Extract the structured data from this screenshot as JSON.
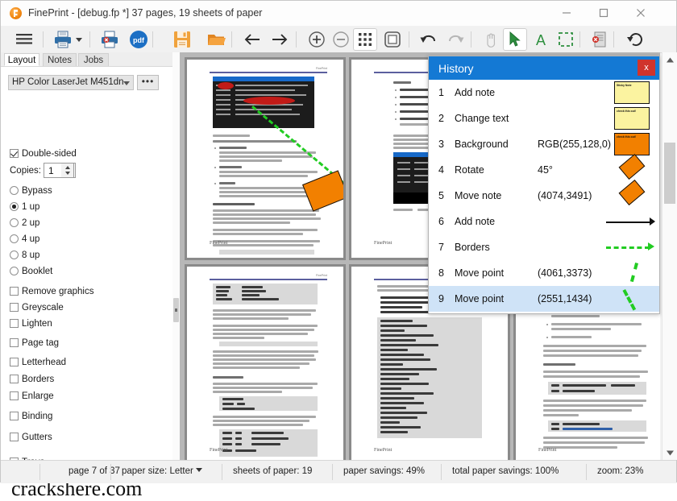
{
  "window": {
    "title": "FinePrint - [debug.fp *] 37 pages, 19 sheets of paper",
    "app_icon": "fineprint-logo-icon",
    "minimize": "minimize-icon",
    "maximize": "maximize-icon",
    "close": "close-icon"
  },
  "toolbar": {
    "buttons": [
      {
        "name": "menu-button",
        "icon": "hamburger-menu-icon"
      },
      {
        "name": "print-button",
        "icon": "printer-icon"
      },
      {
        "name": "print-dropdown",
        "icon": "chevron-down-icon"
      },
      {
        "name": "print-stamp-button",
        "icon": "printer-stamp-icon"
      },
      {
        "name": "pdf-button",
        "icon": "pdf-icon"
      },
      {
        "name": "save-button",
        "icon": "floppy-save-icon"
      },
      {
        "name": "open-button",
        "icon": "open-folder-icon"
      },
      {
        "name": "back-button",
        "icon": "arrow-left-icon"
      },
      {
        "name": "forward-button",
        "icon": "arrow-right-icon"
      },
      {
        "name": "zoom-in-button",
        "icon": "zoom-in-icon"
      },
      {
        "name": "zoom-out-button",
        "icon": "zoom-out-icon"
      },
      {
        "name": "grid-view-button",
        "icon": "grid-icon"
      },
      {
        "name": "fit-page-button",
        "icon": "fit-page-icon"
      },
      {
        "name": "undo-button",
        "icon": "undo-arrow-icon"
      },
      {
        "name": "redo-button",
        "icon": "redo-arrow-icon"
      },
      {
        "name": "hand-tool-button",
        "icon": "hand-icon"
      },
      {
        "name": "select-tool-button",
        "icon": "cursor-arrow-icon"
      },
      {
        "name": "text-tool-button",
        "icon": "letter-a-icon"
      },
      {
        "name": "marquee-tool-button",
        "icon": "dashed-rectangle-icon"
      },
      {
        "name": "delete-page-button",
        "icon": "delete-page-icon"
      },
      {
        "name": "rotate-button",
        "icon": "rotate-clockwise-icon"
      }
    ]
  },
  "sidebar": {
    "tabs": [
      {
        "label": "Layout",
        "selected": true
      },
      {
        "label": "Notes",
        "selected": false
      },
      {
        "label": "Jobs",
        "selected": false
      }
    ],
    "printer": "HP Color LaserJet M451dn",
    "printer_more_label": "•••",
    "double_sided": {
      "label": "Double-sided",
      "checked": true
    },
    "copies": {
      "label": "Copies:",
      "value": "1"
    },
    "layout_options": [
      {
        "label": "Bypass",
        "selected": false
      },
      {
        "label": "1 up",
        "selected": true
      },
      {
        "label": "2 up",
        "selected": false
      },
      {
        "label": "4 up",
        "selected": false
      },
      {
        "label": "8 up",
        "selected": false
      },
      {
        "label": "Booklet",
        "selected": false
      }
    ],
    "checkboxes": [
      {
        "label": "Remove graphics",
        "checked": false
      },
      {
        "label": "Greyscale",
        "checked": false
      },
      {
        "label": "Lighten",
        "checked": false
      },
      {
        "label": "Page tag",
        "checked": false
      },
      {
        "label": "Letterhead",
        "checked": false
      },
      {
        "label": "Borders",
        "checked": false
      },
      {
        "label": "Enlarge",
        "checked": false
      },
      {
        "label": "Binding",
        "checked": false
      },
      {
        "label": "Gutters",
        "checked": false
      },
      {
        "label": "Trays",
        "checked": false
      }
    ],
    "watermark": "crackshere.com"
  },
  "history": {
    "title": "History",
    "close_label": "x",
    "rows": [
      {
        "index": "1",
        "action": "Add note",
        "value": "",
        "thumb": "yellow-sticky-note",
        "note_text": "Sticky Note",
        "selected": false
      },
      {
        "index": "2",
        "action": "Change text",
        "value": "",
        "thumb": "yellow-sticky-note",
        "note_text": "check this out!",
        "selected": false
      },
      {
        "index": "3",
        "action": "Background",
        "value": "RGB(255,128,0)",
        "thumb": "orange-sticky-note",
        "note_text": "check this out!",
        "selected": false
      },
      {
        "index": "4",
        "action": "Rotate",
        "value": "45°",
        "thumb": "orange-diamond-note",
        "note_text": "",
        "selected": false
      },
      {
        "index": "5",
        "action": "Move note",
        "value": "(4074,3491)",
        "thumb": "orange-diamond-note",
        "note_text": "",
        "selected": false
      },
      {
        "index": "6",
        "action": "Add note",
        "value": "",
        "thumb": "black-arrow",
        "note_text": "",
        "selected": false
      },
      {
        "index": "7",
        "action": "Borders",
        "value": "",
        "thumb": "green-dashed-arrow",
        "note_text": "",
        "selected": false
      },
      {
        "index": "8",
        "action": "Move point",
        "value": "(4061,3373)",
        "thumb": "green-dashed-segment",
        "note_text": "",
        "selected": false
      },
      {
        "index": "9",
        "action": "Move point",
        "value": "(2551,1434)",
        "thumb": "green-dashed-segment",
        "note_text": "",
        "selected": true
      }
    ]
  },
  "status": {
    "page": "page 7 of 37",
    "paper_size": "paper size: Letter",
    "sheets": "sheets of paper: 19",
    "savings": "paper savings: 49%",
    "total_savings": "total paper savings: 100%",
    "zoom": "zoom: 23%"
  },
  "colors": {
    "accent_blue": "#1479d4",
    "close_red": "#d0342c",
    "note_orange": "#f28000",
    "note_yellow": "#fbf3a0",
    "annotation_green": "#22cc22",
    "selection_blue": "#cfe3f7"
  }
}
